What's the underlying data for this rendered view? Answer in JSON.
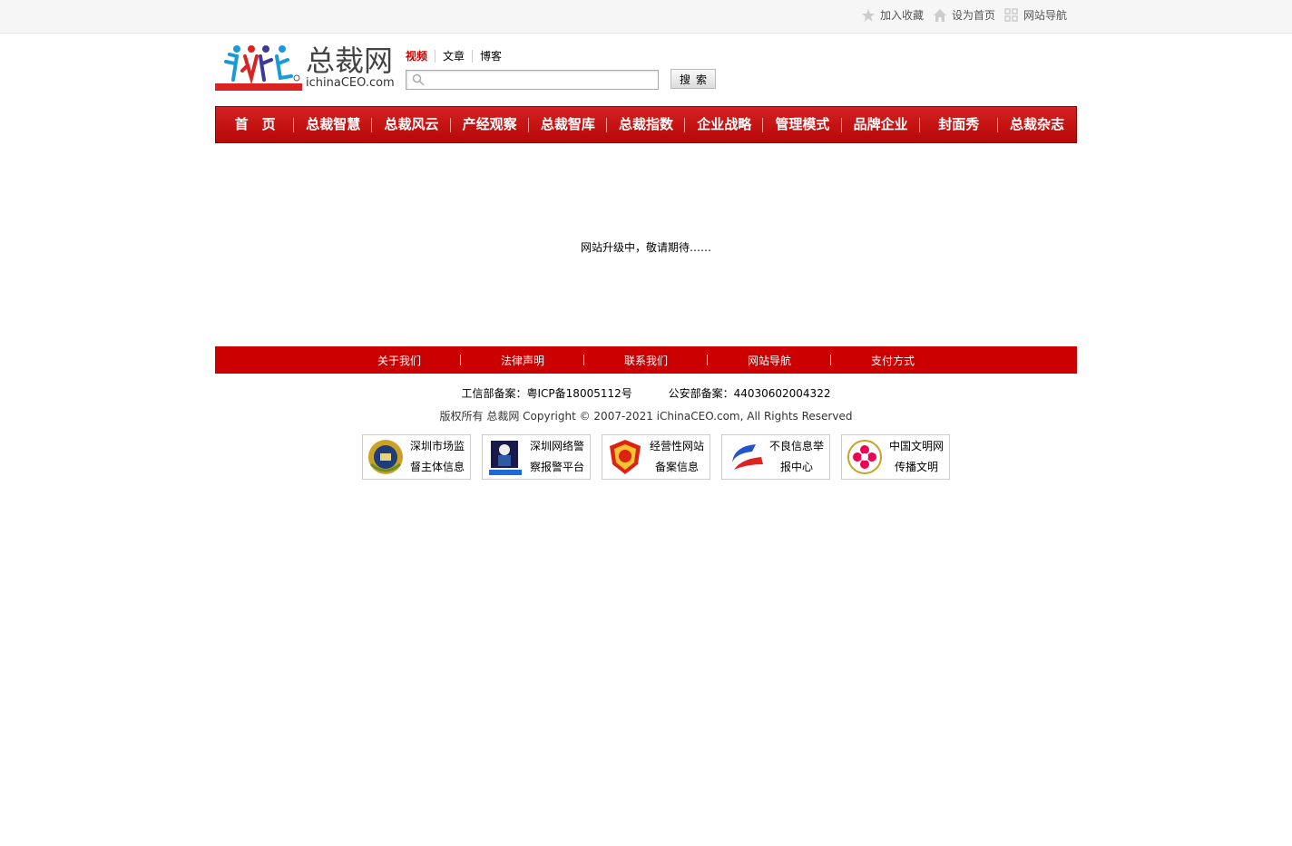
{
  "topbar": {
    "links": [
      {
        "label": "加入收藏",
        "icon": "star-icon"
      },
      {
        "label": "设为首页",
        "icon": "home-icon"
      },
      {
        "label": "网站导航",
        "icon": "grid-icon"
      }
    ]
  },
  "logo": {
    "brand_cn": "总裁网",
    "brand_en": "ichinaCEO.com"
  },
  "search": {
    "tabs": [
      "视频",
      "文章",
      "博客"
    ],
    "placeholder": "",
    "button_label": "搜索"
  },
  "nav": {
    "items": [
      "首　页",
      "总裁智慧",
      "总裁风云",
      "产经观察",
      "总裁智库",
      "总裁指数",
      "企业战略",
      "管理模式",
      "品牌企业",
      "封面秀",
      "总裁杂志"
    ]
  },
  "notice": "网站升级中，敬请期待……",
  "footer": {
    "links": [
      "关于我们",
      "法律声明",
      "联系我们",
      "网站导航",
      "支付方式"
    ],
    "icp": "工信部备案：粤ICP备18005112号",
    "police": "公安部备案：44030602004322",
    "copyright": "版权所有 总裁网 Copyright © 2007-2021 iChinaCEO.com, All Rights Reserved",
    "badges": [
      {
        "line1": "深圳市场监",
        "line2": "督主体信息",
        "icon": "market-supervision-emblem-icon"
      },
      {
        "line1": "深圳网络警",
        "line2": "察报警平台",
        "icon": "cyber-police-icon"
      },
      {
        "line1": "经营性网站",
        "line2": "备案信息",
        "icon": "business-website-badge-icon"
      },
      {
        "line1": "不良信息举",
        "line2": "报中心",
        "icon": "report-center-icon"
      },
      {
        "line1": "中国文明网",
        "line2": "传播文明",
        "icon": "civilization-icon"
      }
    ]
  }
}
